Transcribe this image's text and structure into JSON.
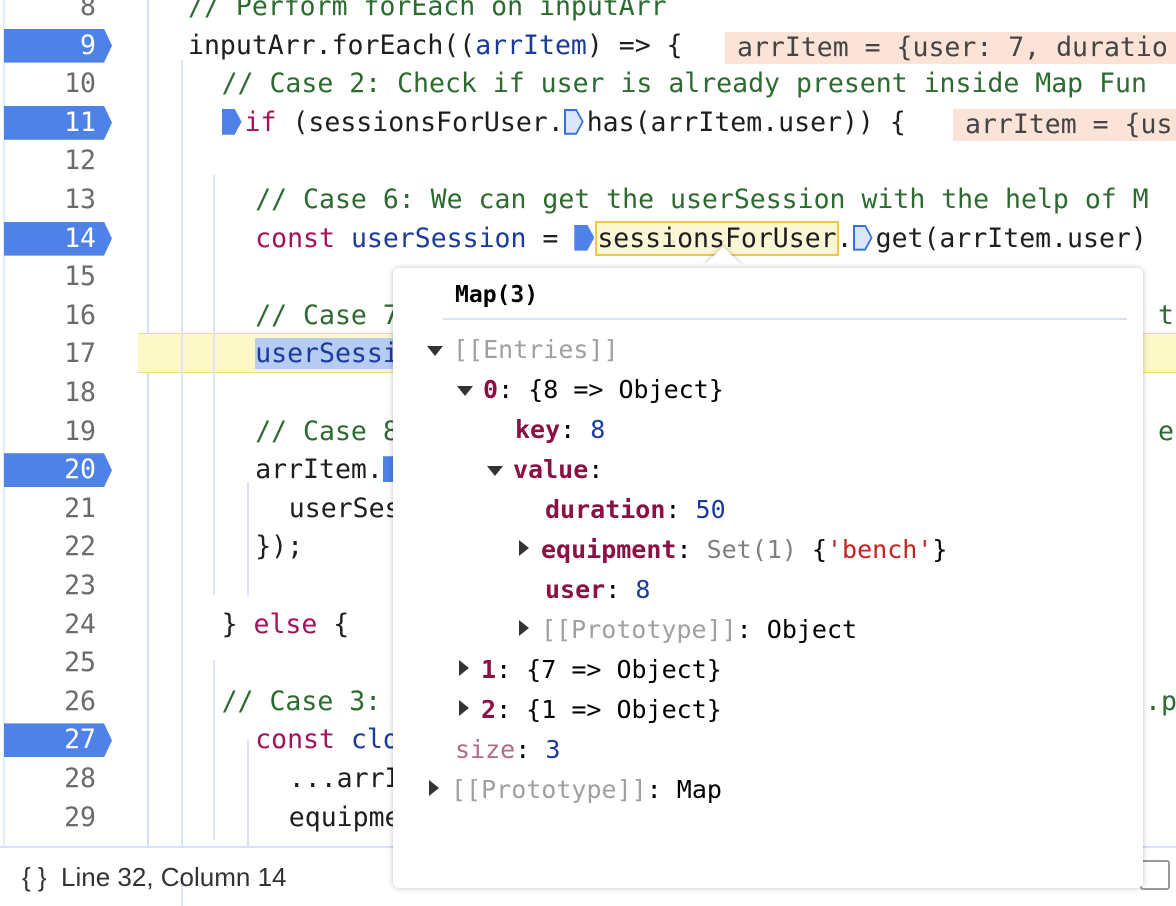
{
  "editor": {
    "lines": [
      {
        "n": 8,
        "bp": false,
        "indent": 0,
        "segs": [
          {
            "k": "comment",
            "t": "// Perform forEach on inputArr"
          }
        ]
      },
      {
        "n": 9,
        "bp": true,
        "indent": 0,
        "segs": [
          {
            "k": "plain",
            "t": "inputArr.forEach(("
          },
          {
            "k": "var",
            "t": "arrItem"
          },
          {
            "k": "plain",
            "t": ") => {"
          }
        ]
      },
      {
        "n": 10,
        "bp": false,
        "indent": 2,
        "segs": [
          {
            "k": "comment",
            "t": "// Case 2: Check if user is already present inside Map Fun"
          }
        ]
      },
      {
        "n": 11,
        "bp": true,
        "indent": 2,
        "segs": [
          {
            "k": "marker",
            "t": ""
          },
          {
            "k": "kw",
            "t": "if"
          },
          {
            "k": "plain",
            "t": " (sessionsForUser."
          },
          {
            "k": "hollow",
            "t": ""
          },
          {
            "k": "plain",
            "t": "has(arrItem.user)) {"
          }
        ]
      },
      {
        "n": 12,
        "bp": false,
        "indent": 0,
        "segs": []
      },
      {
        "n": 13,
        "bp": false,
        "indent": 4,
        "segs": [
          {
            "k": "comment",
            "t": "// Case 6: We can get the userSession with the help of M"
          }
        ]
      },
      {
        "n": 14,
        "bp": true,
        "indent": 4,
        "segs": [
          {
            "k": "kw",
            "t": "const"
          },
          {
            "k": "plain",
            "t": " "
          },
          {
            "k": "var",
            "t": "userSession"
          },
          {
            "k": "plain",
            "t": " = "
          },
          {
            "k": "marker",
            "t": ""
          },
          {
            "k": "hl",
            "t": "sessionsForUser"
          },
          {
            "k": "plain",
            "t": "."
          },
          {
            "k": "hollow",
            "t": ""
          },
          {
            "k": "plain",
            "t": "get(arrItem.user)"
          }
        ]
      },
      {
        "n": 15,
        "bp": false,
        "indent": 0,
        "segs": []
      },
      {
        "n": 16,
        "bp": false,
        "indent": 4,
        "segs": [
          {
            "k": "comment",
            "t": "// Case 7"
          }
        ]
      },
      {
        "n": 17,
        "bp": false,
        "indent": 4,
        "segs": [
          {
            "k": "sel",
            "t": "userSessi"
          }
        ]
      },
      {
        "n": 18,
        "bp": false,
        "indent": 0,
        "segs": []
      },
      {
        "n": 19,
        "bp": false,
        "indent": 4,
        "segs": [
          {
            "k": "comment",
            "t": "// Case 8"
          }
        ]
      },
      {
        "n": 20,
        "bp": true,
        "indent": 4,
        "segs": [
          {
            "k": "plain",
            "t": "arrItem."
          },
          {
            "k": "marker",
            "t": ""
          }
        ]
      },
      {
        "n": 21,
        "bp": false,
        "indent": 6,
        "segs": [
          {
            "k": "plain",
            "t": "userSes"
          }
        ]
      },
      {
        "n": 22,
        "bp": false,
        "indent": 4,
        "segs": [
          {
            "k": "plain",
            "t": "});"
          }
        ]
      },
      {
        "n": 23,
        "bp": false,
        "indent": 0,
        "segs": []
      },
      {
        "n": 24,
        "bp": false,
        "indent": 2,
        "segs": [
          {
            "k": "plain",
            "t": "} "
          },
          {
            "k": "kw",
            "t": "else"
          },
          {
            "k": "plain",
            "t": " {"
          }
        ]
      },
      {
        "n": 25,
        "bp": false,
        "indent": 0,
        "segs": []
      },
      {
        "n": 26,
        "bp": false,
        "indent": 2,
        "segs": [
          {
            "k": "comment",
            "t": "// Case 3:"
          }
        ]
      },
      {
        "n": 27,
        "bp": true,
        "indent": 4,
        "segs": [
          {
            "k": "kw",
            "t": "const"
          },
          {
            "k": "plain",
            "t": " "
          },
          {
            "k": "var",
            "t": "clo"
          }
        ]
      },
      {
        "n": 28,
        "bp": false,
        "indent": 6,
        "segs": [
          {
            "k": "plain",
            "t": "...arrI"
          }
        ]
      },
      {
        "n": 29,
        "bp": false,
        "indent": 6,
        "segs": [
          {
            "k": "plain",
            "t": "equipme"
          }
        ]
      }
    ],
    "right_fragments": [
      {
        "line": 16,
        "t": "t"
      },
      {
        "line": 19,
        "t": "e"
      },
      {
        "line": 26,
        "t": ".pm"
      }
    ],
    "inline_values": [
      {
        "line": 9,
        "t": "arrItem = {user: 7, duratio"
      },
      {
        "line": 11,
        "t": "arrItem = {us"
      }
    ]
  },
  "popup": {
    "title": "Map(3)",
    "entries_label": "[[Entries]]",
    "entry0": {
      "key": "0",
      "summary": ": {8 => Object}"
    },
    "key_label": "key",
    "key_value": "8",
    "value_label": "value",
    "duration_label": "duration",
    "duration_value": "50",
    "equipment_label": "equipment",
    "equipment_type": "Set(1) ",
    "equipment_open": "{",
    "equipment_value": "'bench'",
    "equipment_close": "}",
    "user_label": "user",
    "user_value": "8",
    "proto_obj_label": "[[Prototype]]",
    "proto_obj_value": ": Object",
    "entry1": {
      "key": "1",
      "summary": ": {7 => Object}"
    },
    "entry2": {
      "key": "2",
      "summary": ": {1 => Object}"
    },
    "size_label": "size",
    "size_value": "3",
    "proto_map_label": "[[Prototype]]",
    "proto_map_value": ": Map"
  },
  "status": {
    "text": "{ }  Line 32, Column 14"
  }
}
